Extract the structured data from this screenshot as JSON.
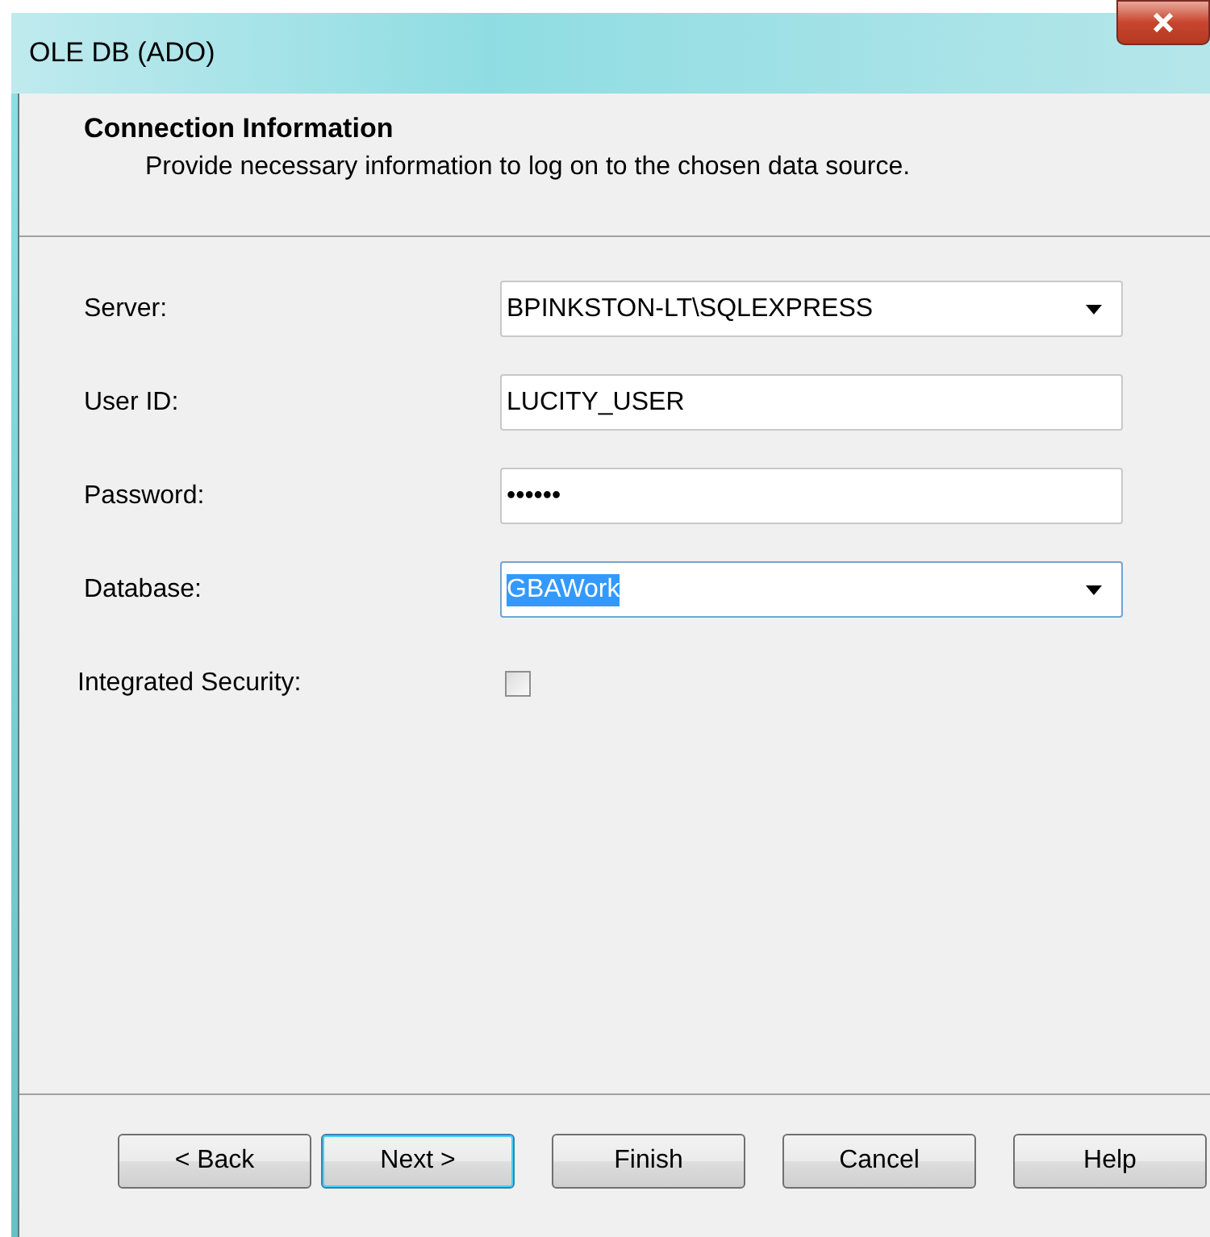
{
  "window": {
    "title": "OLE DB (ADO)"
  },
  "header": {
    "title": "Connection Information",
    "subtitle": "Provide necessary information to log on to the chosen data source."
  },
  "fields": [
    {
      "label": "Server:",
      "kind": "combo",
      "value": "BPINKSTON-LT\\SQLEXPRESS",
      "text_selected": false
    },
    {
      "label": "User ID:",
      "kind": "text",
      "value": "LUCITY_USER",
      "text_selected": false
    },
    {
      "label": "Password:",
      "kind": "text",
      "value": "••••••",
      "text_selected": false
    },
    {
      "label": "Database:",
      "kind": "combo",
      "value": "GBAWork",
      "text_selected": true
    },
    {
      "label": "Integrated Security:",
      "kind": "checkbox",
      "checked": false
    }
  ],
  "buttons": [
    {
      "label": "< Back",
      "default": false
    },
    {
      "label": "Next >",
      "default": true
    },
    {
      "label": "Finish",
      "default": false
    },
    {
      "label": "Cancel",
      "default": false
    },
    {
      "label": "Help",
      "default": false
    }
  ]
}
